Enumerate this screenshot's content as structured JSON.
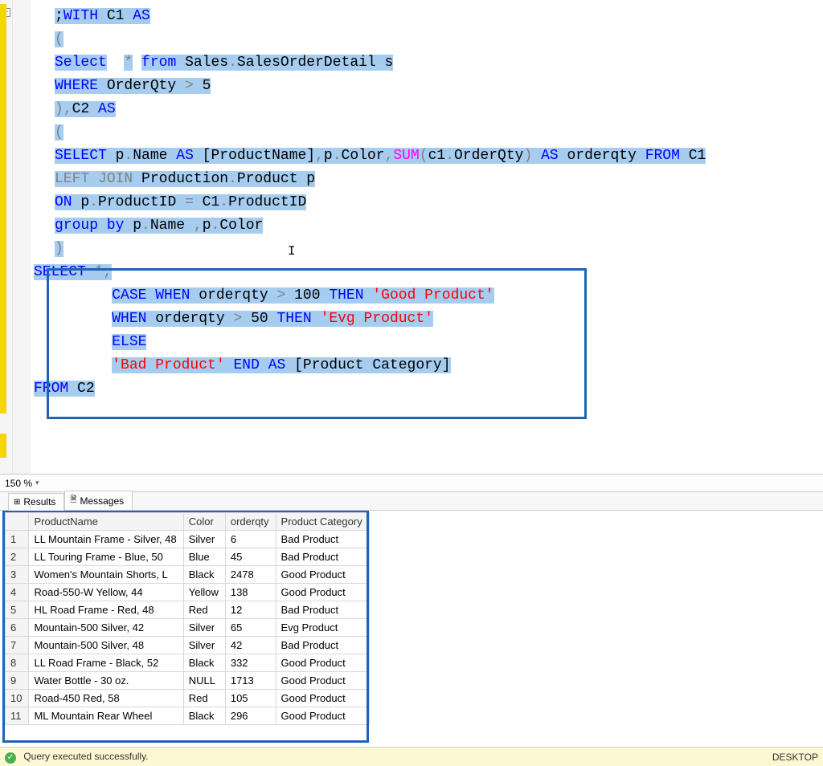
{
  "zoom": {
    "value": "150 %"
  },
  "tabs": {
    "results": {
      "label": "Results",
      "icon": "⊞"
    },
    "messages": {
      "label": "Messages",
      "icon": "🗎"
    }
  },
  "editor": {
    "fold_glyph": "−",
    "lines": [
      [
        {
          "t": ";",
          "c": "plain hl"
        },
        {
          "t": "WITH",
          "c": "kw-blue hl"
        },
        {
          "t": " C1 ",
          "c": "plain hl"
        },
        {
          "t": "AS",
          "c": "kw-blue hl"
        }
      ],
      [
        {
          "t": "(",
          "c": "kw-gray hl"
        }
      ],
      [
        {
          "t": "Select",
          "c": "kw-blue hl"
        },
        {
          "t": "  ",
          "c": "plain"
        },
        {
          "t": "*",
          "c": "kw-gray hl"
        },
        {
          "t": " ",
          "c": "plain"
        },
        {
          "t": "from",
          "c": "kw-blue hl"
        },
        {
          "t": " Sales",
          "c": "plain hl"
        },
        {
          "t": ".",
          "c": "kw-gray hl"
        },
        {
          "t": "SalesOrderDetail s",
          "c": "plain hl"
        }
      ],
      [
        {
          "t": "WHERE",
          "c": "kw-blue hl"
        },
        {
          "t": " OrderQty ",
          "c": "plain hl"
        },
        {
          "t": ">",
          "c": "kw-gray hl"
        },
        {
          "t": " 5",
          "c": "plain hl"
        }
      ],
      [
        {
          "t": ")",
          "c": "kw-gray hl"
        },
        {
          "t": ",",
          "c": "kw-gray hl"
        },
        {
          "t": "C2 ",
          "c": "plain hl"
        },
        {
          "t": "AS",
          "c": "kw-blue hl"
        }
      ],
      [
        {
          "t": "(",
          "c": "kw-gray hl"
        }
      ],
      [
        {
          "t": "SELECT",
          "c": "kw-blue hl"
        },
        {
          "t": " p",
          "c": "plain hl"
        },
        {
          "t": ".",
          "c": "kw-gray hl"
        },
        {
          "t": "Name",
          "c": "plain hl"
        },
        {
          "t": " ",
          "c": "plain hl"
        },
        {
          "t": "AS",
          "c": "kw-blue hl"
        },
        {
          "t": " [ProductName]",
          "c": "plain hl"
        },
        {
          "t": ",",
          "c": "kw-gray hl"
        },
        {
          "t": "p",
          "c": "plain hl"
        },
        {
          "t": ".",
          "c": "kw-gray hl"
        },
        {
          "t": "Color",
          "c": "plain hl"
        },
        {
          "t": ",",
          "c": "kw-gray hl"
        },
        {
          "t": "SUM",
          "c": "kw-pink hl"
        },
        {
          "t": "(",
          "c": "kw-gray hl"
        },
        {
          "t": "c1",
          "c": "plain hl"
        },
        {
          "t": ".",
          "c": "kw-gray hl"
        },
        {
          "t": "OrderQty",
          "c": "plain hl"
        },
        {
          "t": ")",
          "c": "kw-gray hl"
        },
        {
          "t": " ",
          "c": "plain hl"
        },
        {
          "t": "AS",
          "c": "kw-blue hl"
        },
        {
          "t": " orderqty ",
          "c": "plain hl"
        },
        {
          "t": "FROM",
          "c": "kw-blue hl"
        },
        {
          "t": " C1",
          "c": "plain hl"
        }
      ],
      [
        {
          "t": "LEFT",
          "c": "kw-gray hl"
        },
        {
          "t": " ",
          "c": "plain hl"
        },
        {
          "t": "JOIN",
          "c": "kw-gray hl"
        },
        {
          "t": " Production",
          "c": "plain hl"
        },
        {
          "t": ".",
          "c": "kw-gray hl"
        },
        {
          "t": "Product p",
          "c": "plain hl"
        }
      ],
      [
        {
          "t": "ON",
          "c": "kw-blue hl"
        },
        {
          "t": " p",
          "c": "plain hl"
        },
        {
          "t": ".",
          "c": "kw-gray hl"
        },
        {
          "t": "ProductID ",
          "c": "plain hl"
        },
        {
          "t": "=",
          "c": "kw-gray hl"
        },
        {
          "t": " C1",
          "c": "plain hl"
        },
        {
          "t": ".",
          "c": "kw-gray hl"
        },
        {
          "t": "ProductID",
          "c": "plain hl"
        }
      ],
      [
        {
          "t": "group",
          "c": "kw-blue hl"
        },
        {
          "t": " ",
          "c": "plain hl"
        },
        {
          "t": "by",
          "c": "kw-blue hl"
        },
        {
          "t": " p",
          "c": "plain hl"
        },
        {
          "t": ".",
          "c": "kw-gray hl"
        },
        {
          "t": "Name ",
          "c": "plain hl"
        },
        {
          "t": ",",
          "c": "kw-gray hl"
        },
        {
          "t": "p",
          "c": "plain hl"
        },
        {
          "t": ".",
          "c": "kw-gray hl"
        },
        {
          "t": "Color",
          "c": "plain hl"
        }
      ],
      [
        {
          "t": ")",
          "c": "kw-gray hl"
        }
      ],
      [
        {
          "t": "SELECT",
          "c": "kw-blue hl"
        },
        {
          "t": " ",
          "c": "plain hl"
        },
        {
          "t": "*",
          "c": "kw-gray hl"
        },
        {
          "t": ",",
          "c": "kw-gray hl"
        }
      ],
      [
        {
          "t": "         ",
          "c": "plain"
        },
        {
          "t": "CASE",
          "c": "kw-blue hl"
        },
        {
          "t": " ",
          "c": "plain hl"
        },
        {
          "t": "WHEN",
          "c": "kw-blue hl"
        },
        {
          "t": " orderqty ",
          "c": "plain hl"
        },
        {
          "t": ">",
          "c": "kw-gray hl"
        },
        {
          "t": " 100 ",
          "c": "plain hl"
        },
        {
          "t": "THEN",
          "c": "kw-blue hl"
        },
        {
          "t": " ",
          "c": "plain hl"
        },
        {
          "t": "'Good Product'",
          "c": "str-red hl"
        }
      ],
      [
        {
          "t": "         ",
          "c": "plain"
        },
        {
          "t": "WHEN",
          "c": "kw-blue hl"
        },
        {
          "t": " orderqty ",
          "c": "plain hl"
        },
        {
          "t": ">",
          "c": "kw-gray hl"
        },
        {
          "t": " 50 ",
          "c": "plain hl"
        },
        {
          "t": "THEN",
          "c": "kw-blue hl"
        },
        {
          "t": " ",
          "c": "plain hl"
        },
        {
          "t": "'Evg Product'",
          "c": "str-red hl"
        }
      ],
      [
        {
          "t": "         ",
          "c": "plain"
        },
        {
          "t": "ELSE",
          "c": "kw-blue hl"
        }
      ],
      [
        {
          "t": "         ",
          "c": "plain"
        },
        {
          "t": "'Bad Product'",
          "c": "str-red hl"
        },
        {
          "t": " ",
          "c": "plain hl"
        },
        {
          "t": "END",
          "c": "kw-blue hl"
        },
        {
          "t": " ",
          "c": "plain hl"
        },
        {
          "t": "AS",
          "c": "kw-blue hl"
        },
        {
          "t": " [Product Category]",
          "c": "plain hl"
        }
      ],
      [
        {
          "t": "FROM",
          "c": "kw-blue hl"
        },
        {
          "t": " C2",
          "c": "plain hl"
        }
      ]
    ],
    "indents": [
      0,
      0,
      0,
      0,
      0,
      0,
      0,
      0,
      0,
      0,
      0,
      -1,
      -1,
      -1,
      -1,
      -1,
      -1
    ]
  },
  "results": {
    "columns": [
      "ProductName",
      "Color",
      "orderqty",
      "Product Category"
    ],
    "rows": [
      {
        "n": "1",
        "ProductName": "LL Mountain Frame - Silver, 48",
        "Color": "Silver",
        "orderqty": "6",
        "Product Category": "Bad Product",
        "sel": true
      },
      {
        "n": "2",
        "ProductName": "LL Touring Frame - Blue, 50",
        "Color": "Blue",
        "orderqty": "45",
        "Product Category": "Bad Product"
      },
      {
        "n": "3",
        "ProductName": "Women's Mountain Shorts, L",
        "Color": "Black",
        "orderqty": "2478",
        "Product Category": "Good Product"
      },
      {
        "n": "4",
        "ProductName": "Road-550-W Yellow, 44",
        "Color": "Yellow",
        "orderqty": "138",
        "Product Category": "Good Product"
      },
      {
        "n": "5",
        "ProductName": "HL Road Frame - Red, 48",
        "Color": "Red",
        "orderqty": "12",
        "Product Category": "Bad Product"
      },
      {
        "n": "6",
        "ProductName": "Mountain-500 Silver, 42",
        "Color": "Silver",
        "orderqty": "65",
        "Product Category": "Evg Product"
      },
      {
        "n": "7",
        "ProductName": "Mountain-500 Silver, 48",
        "Color": "Silver",
        "orderqty": "42",
        "Product Category": "Bad Product"
      },
      {
        "n": "8",
        "ProductName": "LL Road Frame - Black, 52",
        "Color": "Black",
        "orderqty": "332",
        "Product Category": "Good Product"
      },
      {
        "n": "9",
        "ProductName": "Water Bottle - 30 oz.",
        "Color": "NULL",
        "orderqty": "1713",
        "Product Category": "Good Product",
        "null_color": true
      },
      {
        "n": "10",
        "ProductName": "Road-450 Red, 58",
        "Color": "Red",
        "orderqty": "105",
        "Product Category": "Good Product"
      },
      {
        "n": "11",
        "ProductName": "ML Mountain Rear Wheel",
        "Color": "Black",
        "orderqty": "296",
        "Product Category": "Good Product"
      }
    ]
  },
  "status": {
    "message": "Query executed successfully.",
    "right": "DESKTOP"
  }
}
